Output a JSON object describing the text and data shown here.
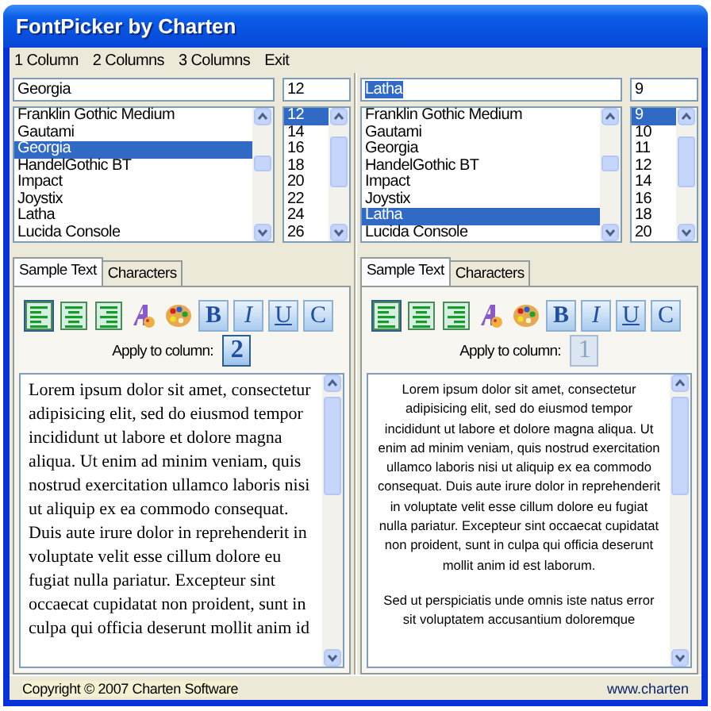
{
  "window": {
    "title": "FontPicker by Charten"
  },
  "menu": [
    "1 Column",
    "2 Columns",
    "3 Columns",
    "Exit"
  ],
  "columns": [
    {
      "font_field": "Georgia",
      "font_field_highlighted": false,
      "size_field": "12",
      "fonts": [
        {
          "label": "Franklin Gothic Medium",
          "selected": false
        },
        {
          "label": "Gautami",
          "selected": false
        },
        {
          "label": "Georgia",
          "selected": true
        },
        {
          "label": "HandelGothic BT",
          "selected": false
        },
        {
          "label": "Impact",
          "selected": false
        },
        {
          "label": "Joystix",
          "selected": false
        },
        {
          "label": "Latha",
          "selected": false
        },
        {
          "label": "Lucida Console",
          "selected": false
        }
      ],
      "sizes": [
        {
          "label": "12",
          "selected": true
        },
        {
          "label": "14",
          "selected": false
        },
        {
          "label": "16",
          "selected": false
        },
        {
          "label": "18",
          "selected": false
        },
        {
          "label": "20",
          "selected": false
        },
        {
          "label": "22",
          "selected": false
        },
        {
          "label": "24",
          "selected": false
        },
        {
          "label": "26",
          "selected": false
        }
      ],
      "tabs": [
        {
          "label": "Sample Text",
          "selected": true
        },
        {
          "label": "Characters",
          "selected": false
        }
      ],
      "tools": [
        {
          "kind": "align-left",
          "selected": true
        },
        {
          "kind": "align-center",
          "selected": false
        },
        {
          "kind": "align-right",
          "selected": false
        },
        {
          "kind": "font"
        },
        {
          "kind": "palette"
        },
        {
          "kind": "bold",
          "label": "B",
          "selected": false
        },
        {
          "kind": "italic",
          "label": "I",
          "selected": false
        },
        {
          "kind": "underline",
          "label": "U",
          "selected": false
        },
        {
          "kind": "caps",
          "label": "C",
          "selected": false
        }
      ],
      "apply_label": "Apply to column:",
      "apply_column": "2",
      "apply_active": true,
      "paragraphs": [
        "Lorem ipsum dolor sit amet, consectetur adipisicing elit, sed do eiusmod tempor incididunt ut labore et dolore magna aliqua. Ut enim ad minim veniam, quis nostrud exercitation ullamco laboris nisi ut aliquip ex ea commodo consequat. Duis aute irure dolor in reprehenderit in voluptate velit esse cillum dolore eu fugiat nulla pariatur. Excepteur sint occaecat cupidatat non proident, sunt in culpa qui officia deserunt mollit anim id"
      ]
    },
    {
      "font_field": "Latha",
      "font_field_highlighted": true,
      "size_field": "9",
      "fonts": [
        {
          "label": "Franklin Gothic Medium",
          "selected": false
        },
        {
          "label": "Gautami",
          "selected": false
        },
        {
          "label": "Georgia",
          "selected": false
        },
        {
          "label": "HandelGothic BT",
          "selected": false
        },
        {
          "label": "Impact",
          "selected": false
        },
        {
          "label": "Joystix",
          "selected": false
        },
        {
          "label": "Latha",
          "selected": true
        },
        {
          "label": "Lucida Console",
          "selected": false
        }
      ],
      "sizes": [
        {
          "label": "9",
          "selected": true
        },
        {
          "label": "10",
          "selected": false
        },
        {
          "label": "11",
          "selected": false
        },
        {
          "label": "12",
          "selected": false
        },
        {
          "label": "14",
          "selected": false
        },
        {
          "label": "16",
          "selected": false
        },
        {
          "label": "18",
          "selected": false
        },
        {
          "label": "20",
          "selected": false
        }
      ],
      "tabs": [
        {
          "label": "Sample Text",
          "selected": true
        },
        {
          "label": "Characters",
          "selected": false
        }
      ],
      "tools": [
        {
          "kind": "align-left",
          "selected": true
        },
        {
          "kind": "align-center",
          "selected": false
        },
        {
          "kind": "align-right",
          "selected": false
        },
        {
          "kind": "font"
        },
        {
          "kind": "palette"
        },
        {
          "kind": "bold",
          "label": "B",
          "selected": false
        },
        {
          "kind": "italic",
          "label": "I",
          "selected": false
        },
        {
          "kind": "underline",
          "label": "U",
          "selected": false
        },
        {
          "kind": "caps",
          "label": "C",
          "selected": false
        }
      ],
      "apply_label": "Apply to column:",
      "apply_column": "1",
      "apply_active": false,
      "paragraphs": [
        "Lorem ipsum dolor sit amet, consectetur adipisicing elit, sed do eiusmod tempor incididunt ut labore et dolore magna aliqua. Ut enim ad minim veniam, quis nostrud exercitation ullamco laboris nisi ut aliquip ex ea commodo consequat. Duis aute irure dolor in reprehenderit in voluptate velit esse cillum dolore eu fugiat nulla pariatur. Excepteur sint occaecat cupidatat non proident, sunt in culpa qui officia deserunt mollit anim id est laborum.",
        "Sed ut perspiciatis unde omnis iste natus error sit voluptatem accusantium doloremque"
      ]
    }
  ],
  "status_bar": {
    "copyright": "Copyright © 2007 Charten Software",
    "link": "www.charten"
  }
}
